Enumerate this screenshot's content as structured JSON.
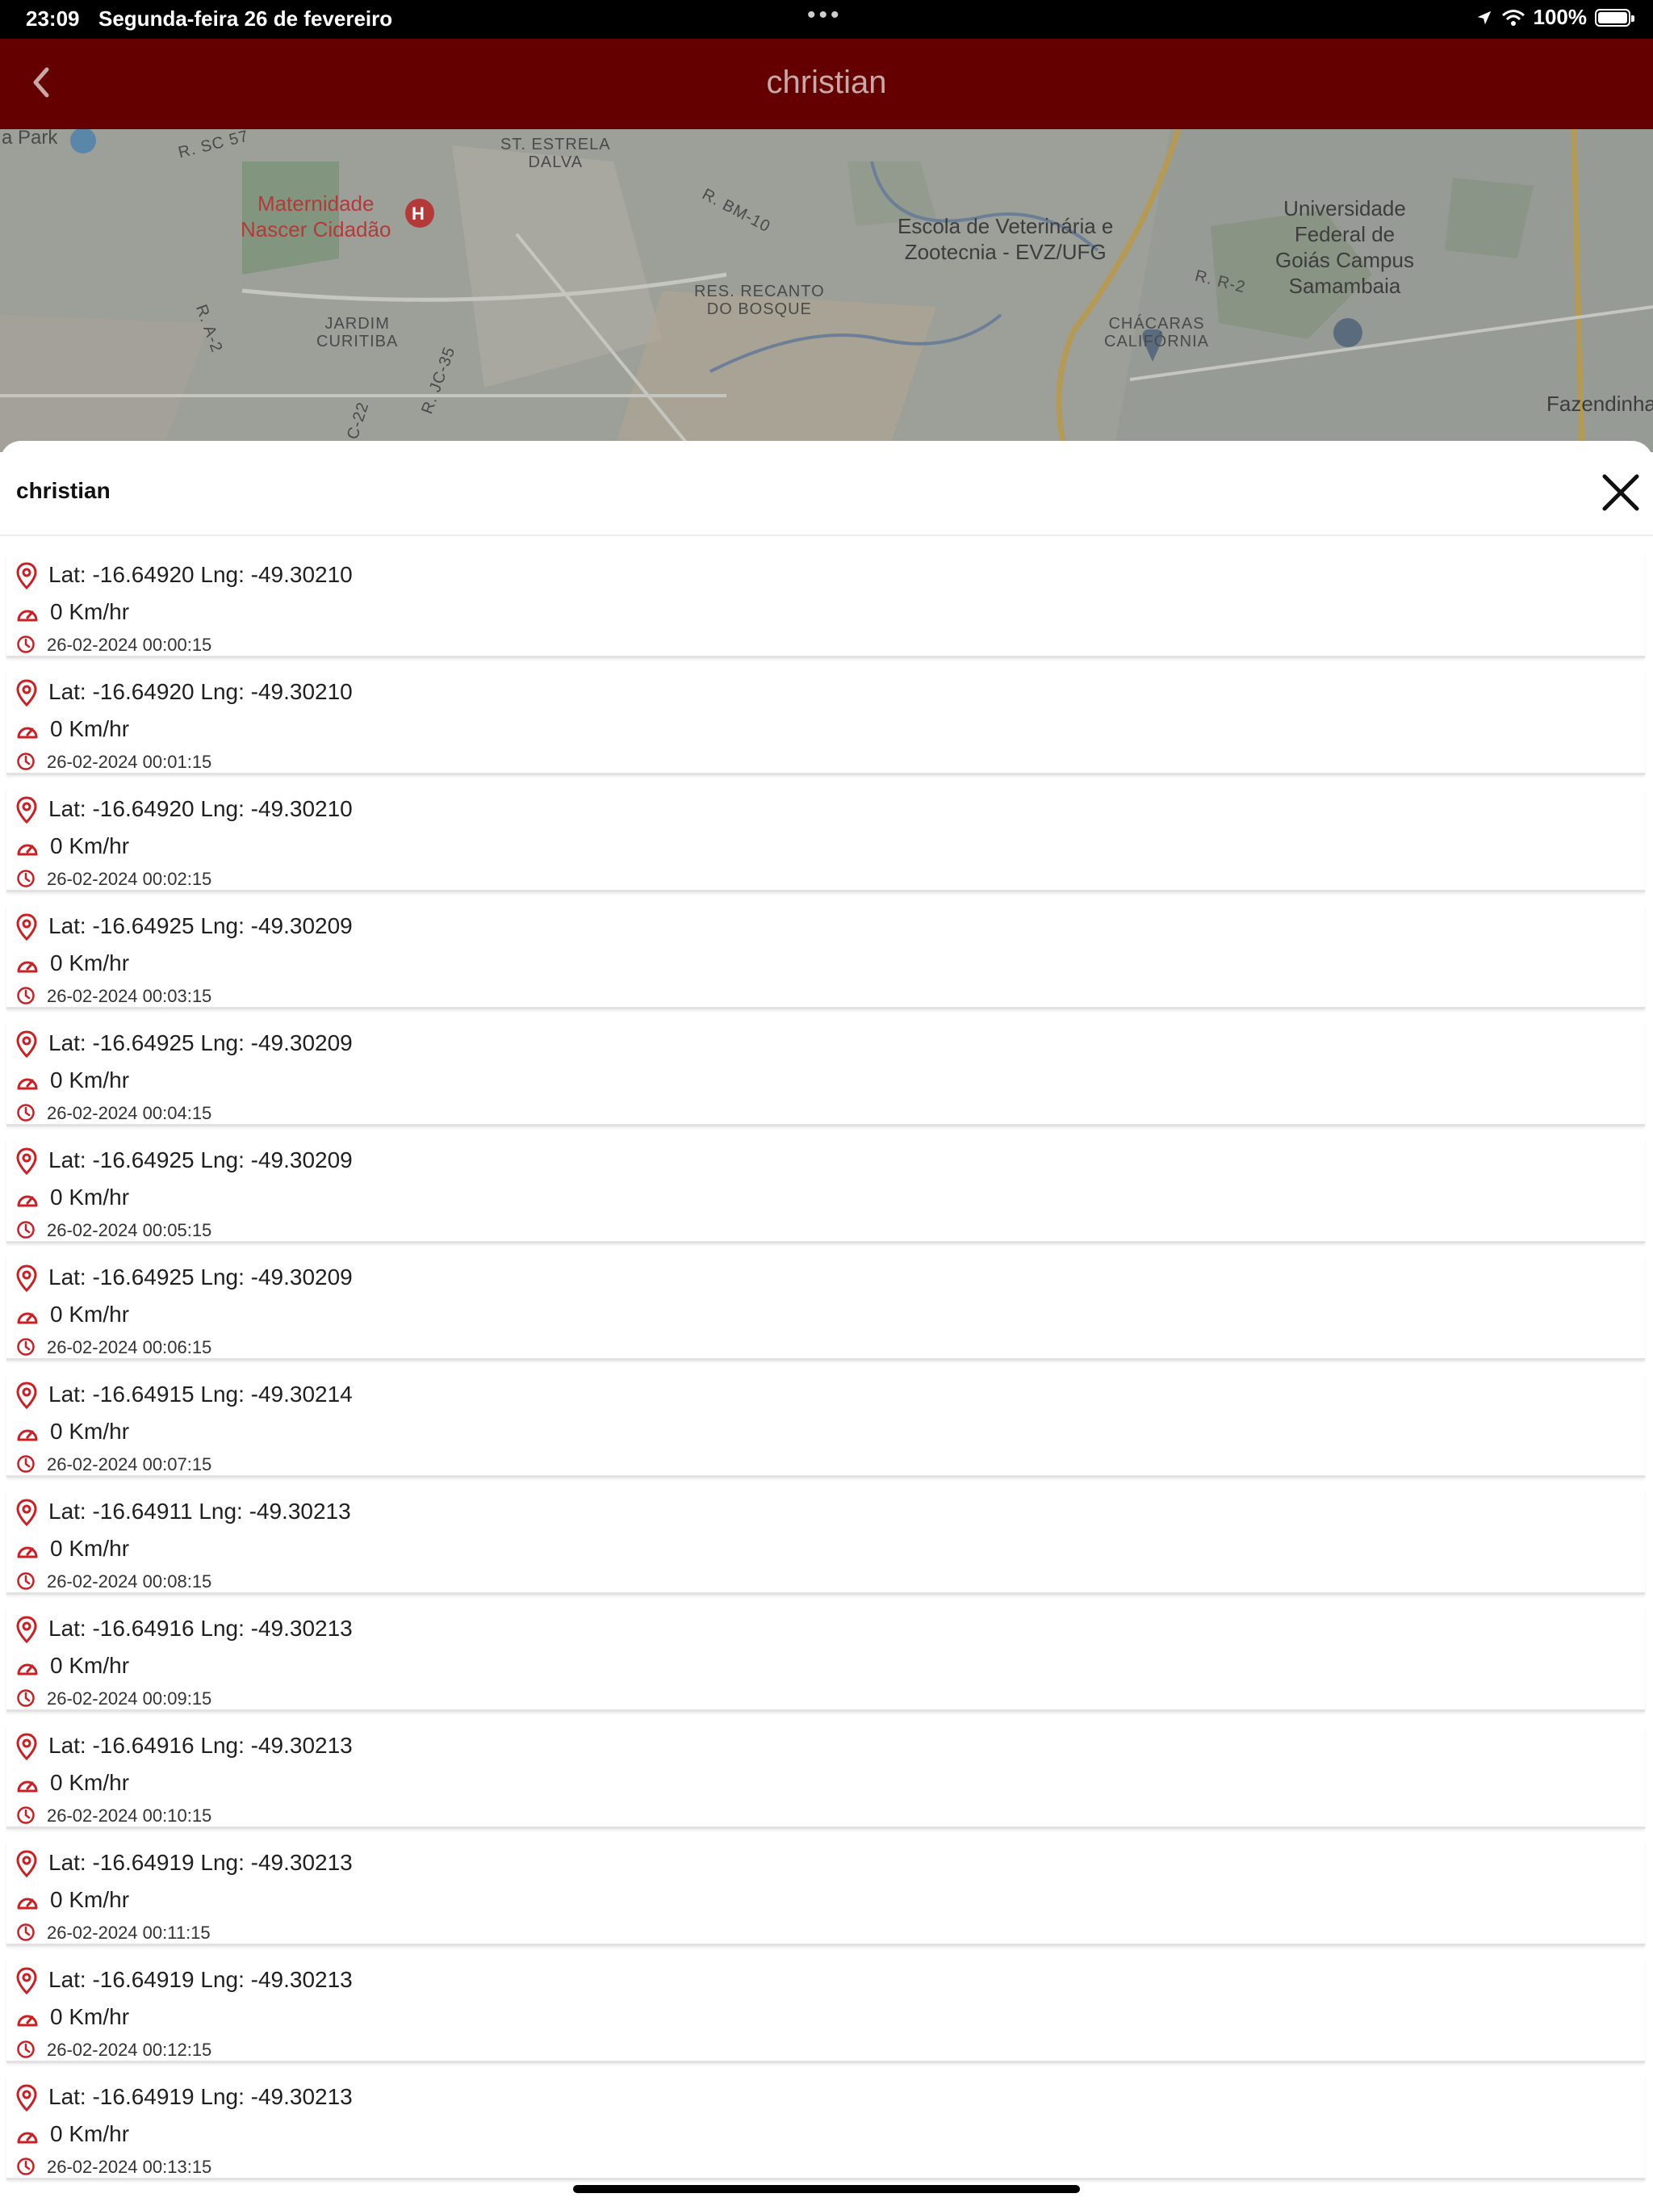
{
  "status_bar": {
    "time": "23:09",
    "date": "Segunda-feira 26 de fevereiro",
    "battery": "100%"
  },
  "header": {
    "title": "christian",
    "icons": {
      "back": "chevron-left-icon"
    }
  },
  "map": {
    "labels": {
      "park": "a Park",
      "sc57": "R. SC 57",
      "estrela": "ST. ESTRELA\nDALVA",
      "maternidade": "Maternidade\nNascer Cidadão",
      "bm10": "R. BM-10",
      "escola": "Escola de Veterinária e\nZootecnia - EVZ/UFG",
      "universidade": "Universidade\nFederal de\nGoiás Campus\nSamambaia",
      "rr2": "R. R-2",
      "recanto": "RES. RECANTO\nDO BOSQUE",
      "jardim": "JARDIM\nCURITIBA",
      "ra2": "R. A-2",
      "chacaras": "CHÁCARAS\nCALIFÓRNIA",
      "jc35": "R. JC-35",
      "c22": "C-22",
      "fazendinha": "Fazendinha"
    }
  },
  "sheet": {
    "title": "christian",
    "icons": {
      "close": "close-icon",
      "location": "map-pin-icon",
      "speed": "speedometer-icon",
      "time": "clock-icon"
    },
    "accent_color": "#cc1f24",
    "rows": [
      {
        "coord": "Lat: -16.64920 Lng: -49.30210",
        "speed": "0 Km/hr",
        "time": "26-02-2024 00:00:15"
      },
      {
        "coord": "Lat: -16.64920 Lng: -49.30210",
        "speed": "0 Km/hr",
        "time": "26-02-2024 00:01:15"
      },
      {
        "coord": "Lat: -16.64920 Lng: -49.30210",
        "speed": "0 Km/hr",
        "time": "26-02-2024 00:02:15"
      },
      {
        "coord": "Lat: -16.64925 Lng: -49.30209",
        "speed": "0 Km/hr",
        "time": "26-02-2024 00:03:15"
      },
      {
        "coord": "Lat: -16.64925 Lng: -49.30209",
        "speed": "0 Km/hr",
        "time": "26-02-2024 00:04:15"
      },
      {
        "coord": "Lat: -16.64925 Lng: -49.30209",
        "speed": "0 Km/hr",
        "time": "26-02-2024 00:05:15"
      },
      {
        "coord": "Lat: -16.64925 Lng: -49.30209",
        "speed": "0 Km/hr",
        "time": "26-02-2024 00:06:15"
      },
      {
        "coord": "Lat: -16.64915 Lng: -49.30214",
        "speed": "0 Km/hr",
        "time": "26-02-2024 00:07:15"
      },
      {
        "coord": "Lat: -16.64911 Lng: -49.30213",
        "speed": "0 Km/hr",
        "time": "26-02-2024 00:08:15"
      },
      {
        "coord": "Lat: -16.64916 Lng: -49.30213",
        "speed": "0 Km/hr",
        "time": "26-02-2024 00:09:15"
      },
      {
        "coord": "Lat: -16.64916 Lng: -49.30213",
        "speed": "0 Km/hr",
        "time": "26-02-2024 00:10:15"
      },
      {
        "coord": "Lat: -16.64919 Lng: -49.30213",
        "speed": "0 Km/hr",
        "time": "26-02-2024 00:11:15"
      },
      {
        "coord": "Lat: -16.64919 Lng: -49.30213",
        "speed": "0 Km/hr",
        "time": "26-02-2024 00:12:15"
      },
      {
        "coord": "Lat: -16.64919 Lng: -49.30213",
        "speed": "0 Km/hr",
        "time": "26-02-2024 00:13:15"
      }
    ]
  }
}
